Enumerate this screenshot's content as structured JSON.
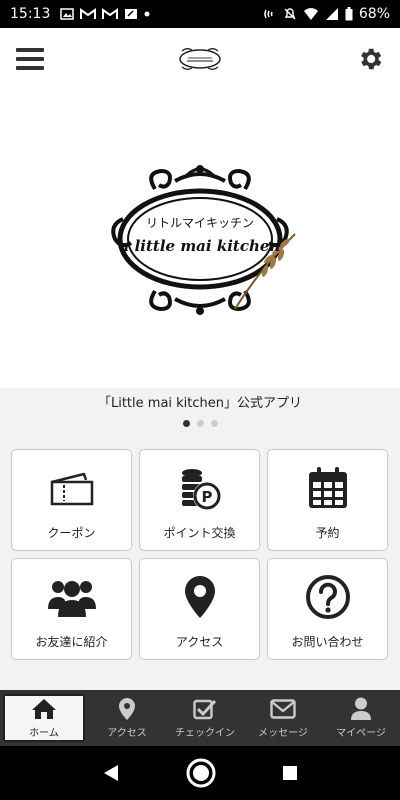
{
  "status_bar": {
    "time": "15:13",
    "battery": "68%"
  },
  "header": {
    "menu_icon": "hamburger-menu-icon",
    "settings_icon": "gear-icon"
  },
  "hero": {
    "logo_line1": "リトルマイキッチン",
    "logo_line2": "a little mai kitchen"
  },
  "caption": "「Little mai kitchen」公式アプリ",
  "pagination": {
    "total": 3,
    "active": 1
  },
  "tiles": [
    {
      "label": "クーポン",
      "icon": "ticket-icon"
    },
    {
      "label": "ポイント交換",
      "icon": "coins-point-icon"
    },
    {
      "label": "予約",
      "icon": "calendar-icon"
    },
    {
      "label": "お友達に紹介",
      "icon": "users-icon"
    },
    {
      "label": "アクセス",
      "icon": "map-pin-icon"
    },
    {
      "label": "お問い合わせ",
      "icon": "question-circle-icon"
    }
  ],
  "bottom_nav": [
    {
      "label": "ホーム",
      "icon": "home-icon",
      "active": true
    },
    {
      "label": "アクセス",
      "icon": "map-pin-icon",
      "active": false
    },
    {
      "label": "チェックイン",
      "icon": "checkbox-icon",
      "active": false
    },
    {
      "label": "メッセージ",
      "icon": "envelope-icon",
      "active": false
    },
    {
      "label": "マイページ",
      "icon": "user-icon",
      "active": false
    }
  ],
  "colors": {
    "nav_bg": "#333333",
    "icon_dark": "#222222",
    "page_bg": "#f2f2f2"
  }
}
